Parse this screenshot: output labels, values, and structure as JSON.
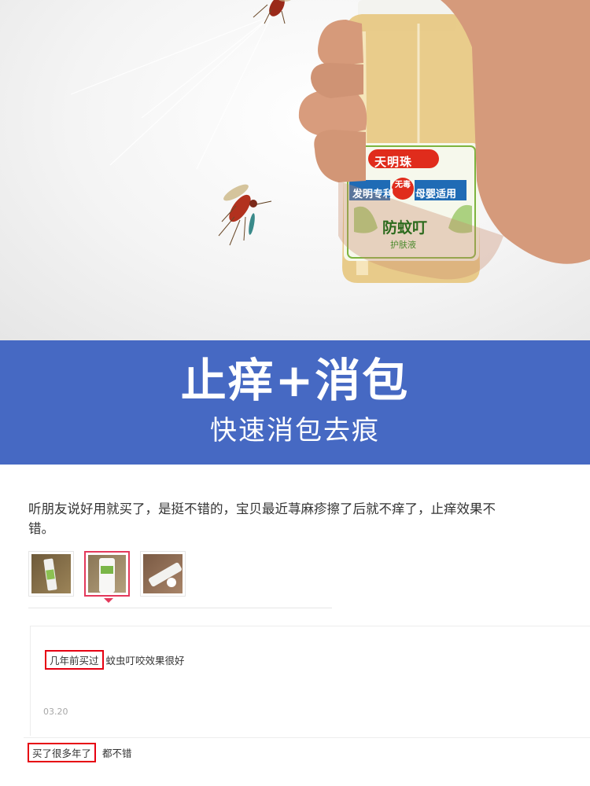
{
  "product": {
    "brand": "天明珠",
    "label_left": "发明专利",
    "label_badge": "无毒",
    "label_right": "母婴适用",
    "name": "防蚊叮",
    "subname": "护肤液"
  },
  "banner": {
    "title": "止痒+消包",
    "subtitle": "快速消包去痕",
    "color": "#4669c3"
  },
  "review": {
    "text": "听朋友说好用就买了，是挺不错的，宝贝最近荨麻疹擦了后就不痒了，止痒效果不错。",
    "thumbnails": [
      "tube-photo-1",
      "tube-photo-2",
      "tube-photo-3"
    ],
    "selected_thumbnail": 1,
    "append": {
      "highlight": "几年前买过",
      "text": "蚊虫叮咬效果很好",
      "date": "03.20"
    },
    "second": {
      "highlight": "买了很多年了",
      "text": "都不错"
    },
    "highlight_color": "#e60012"
  }
}
